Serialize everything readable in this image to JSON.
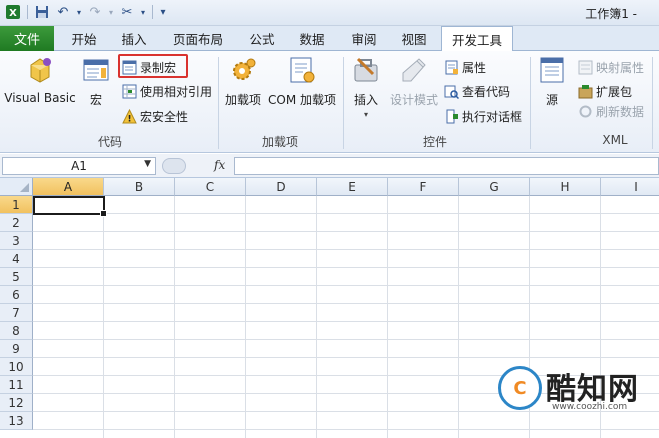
{
  "window": {
    "title": "工作簿1 -"
  },
  "qat": {
    "icons": [
      "excel-icon",
      "save-icon",
      "undo-icon",
      "redo-icon",
      "customize-icon"
    ]
  },
  "tabs": [
    {
      "label": "文件",
      "id": "file"
    },
    {
      "label": "开始",
      "id": "home"
    },
    {
      "label": "插入",
      "id": "insert"
    },
    {
      "label": "页面布局",
      "id": "page-layout"
    },
    {
      "label": "公式",
      "id": "formulas"
    },
    {
      "label": "数据",
      "id": "data"
    },
    {
      "label": "审阅",
      "id": "review"
    },
    {
      "label": "视图",
      "id": "view"
    },
    {
      "label": "开发工具",
      "id": "developer",
      "active": true
    }
  ],
  "ribbon": {
    "code": {
      "label": "代码",
      "visual_basic": "Visual Basic",
      "macros": "宏",
      "record_macro": "录制宏",
      "relative_ref": "使用相对引用",
      "macro_security": "宏安全性"
    },
    "addins": {
      "label": "加载项",
      "addins": "加载项",
      "com_addins": "COM 加载项"
    },
    "controls": {
      "label": "控件",
      "insert": "插入",
      "design_mode": "设计模式",
      "properties": "属性",
      "view_code": "查看代码",
      "run_dialog": "执行对话框"
    },
    "xml": {
      "label": "XML",
      "source": "源",
      "map_properties": "映射属性",
      "expansion_packs": "扩展包",
      "refresh_data": "刷新数据"
    }
  },
  "formula_bar": {
    "name_box": "A1",
    "fx": "fx",
    "formula": ""
  },
  "grid": {
    "columns": [
      "A",
      "B",
      "C",
      "D",
      "E",
      "F",
      "G",
      "H",
      "I"
    ],
    "rows": [
      "1",
      "2",
      "3",
      "4",
      "5",
      "6",
      "7",
      "8",
      "9",
      "10",
      "11",
      "12",
      "13"
    ],
    "selected_cell": "A1"
  },
  "watermark": {
    "logo_letter": "C",
    "text": "酷知网",
    "url": "www.coozhi.com"
  },
  "colors": {
    "file_tab": "#2a8a2d",
    "highlight_border": "#d9322f",
    "selected_header": "#f5cf73"
  }
}
